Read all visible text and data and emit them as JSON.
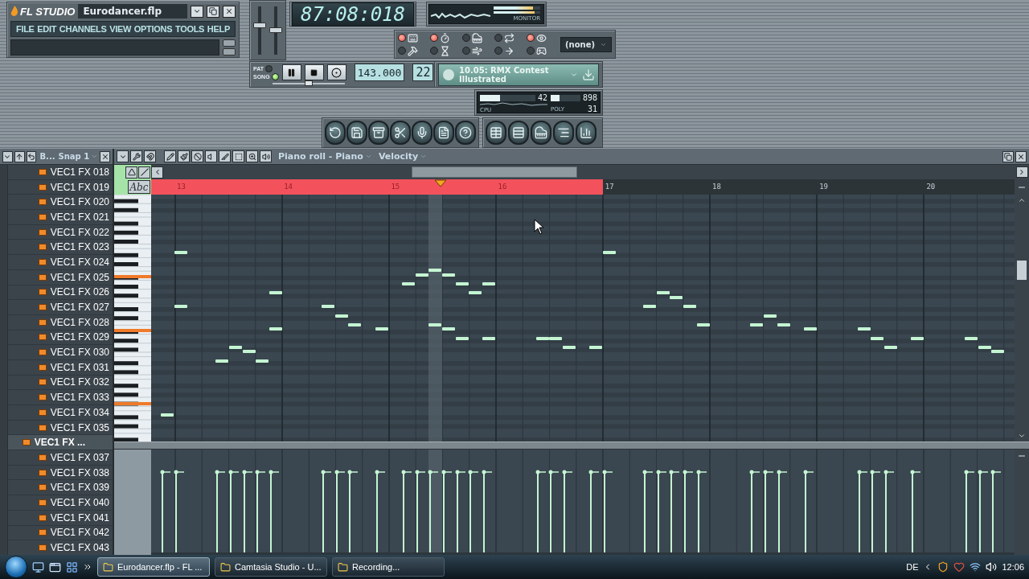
{
  "app": {
    "logo": "FL STUDIO",
    "filename": "Eurodancer.flp"
  },
  "menu": [
    "FILE",
    "EDIT",
    "CHANNELS",
    "VIEW",
    "OPTIONS",
    "TOOLS",
    "HELP"
  ],
  "mixer_sliders": [
    {
      "level": 0.62
    },
    {
      "level": 0.5
    }
  ],
  "time_display": "87:08:018",
  "monitor": {
    "label": "MONITOR",
    "meters": [
      {
        "level": 0.85
      },
      {
        "level": 0.88
      }
    ]
  },
  "record_toggles": [
    {
      "kind": "keyboard",
      "on": true
    },
    {
      "kind": "countdown",
      "on": true
    },
    {
      "kind": "step",
      "on": false
    },
    {
      "kind": "loop",
      "on": false
    },
    {
      "kind": "eye",
      "on": true
    },
    {
      "kind": "hammer",
      "on": false
    },
    {
      "kind": "wait",
      "on": false
    },
    {
      "kind": "blend",
      "on": false
    },
    {
      "kind": "arrow",
      "on": false
    },
    {
      "kind": "joystick",
      "on": false
    }
  ],
  "output_dropdown": "(none)",
  "transport": {
    "modes": [
      {
        "label": "PAT",
        "selected": false
      },
      {
        "label": "SONG",
        "selected": true
      }
    ],
    "tempo": "143.000",
    "pattern": "22",
    "slider": {
      "level": 0.5
    }
  },
  "song_info": {
    "lines": [
      "10.05: RMX Contest",
      "Illustrated"
    ]
  },
  "performance": {
    "cpu": {
      "label": "CPU",
      "value": "42",
      "level": 0.36
    },
    "memory": {
      "value": "898",
      "level": 0.3
    },
    "poly": {
      "label": "POLY",
      "value": "31"
    }
  },
  "browser": {
    "title": "B...",
    "snap": "Snap 1",
    "items": [
      {
        "label": "VEC1 FX 018",
        "selected": false
      },
      {
        "label": "VEC1 FX 019",
        "selected": false
      },
      {
        "label": "VEC1 FX 020",
        "selected": false
      },
      {
        "label": "VEC1 FX 021",
        "selected": false
      },
      {
        "label": "VEC1 FX 022",
        "selected": false
      },
      {
        "label": "VEC1 FX 023",
        "selected": false
      },
      {
        "label": "VEC1 FX 024",
        "selected": false
      },
      {
        "label": "VEC1 FX 025",
        "selected": false
      },
      {
        "label": "VEC1 FX 026",
        "selected": false
      },
      {
        "label": "VEC1 FX 027",
        "selected": false
      },
      {
        "label": "VEC1 FX 028",
        "selected": false
      },
      {
        "label": "VEC1 FX 029",
        "selected": false
      },
      {
        "label": "VEC1 FX 030",
        "selected": false
      },
      {
        "label": "VEC1 FX 031",
        "selected": false
      },
      {
        "label": "VEC1 FX 032",
        "selected": false
      },
      {
        "label": "VEC1 FX 033",
        "selected": false
      },
      {
        "label": "VEC1 FX 034",
        "selected": false
      },
      {
        "label": "VEC1 FX 035",
        "selected": false
      },
      {
        "label": "VEC1 FX ...",
        "selected": true
      },
      {
        "label": "VEC1 FX 037",
        "selected": false
      },
      {
        "label": "VEC1 FX 038",
        "selected": false
      },
      {
        "label": "VEC1 FX 039",
        "selected": false
      },
      {
        "label": "VEC1 FX 040",
        "selected": false
      },
      {
        "label": "VEC1 FX 041",
        "selected": false
      },
      {
        "label": "VEC1 FX 042",
        "selected": false
      },
      {
        "label": "VEC1 FX 043",
        "selected": false
      }
    ]
  },
  "piano_roll": {
    "title": "Piano roll - Piano",
    "target": "Velocity",
    "abc_button": "Abc",
    "bars": [
      "13",
      "14",
      "15",
      "16",
      "17",
      "18",
      "19",
      "20"
    ]
  },
  "taskbar": {
    "tasks": [
      {
        "label": "Eurodancer.flp - FL ...",
        "selected": true
      },
      {
        "label": "Camtasia Studio - U...",
        "selected": false
      },
      {
        "label": "Recording...",
        "selected": false
      }
    ],
    "language": "DE",
    "clock": "12:06"
  }
}
